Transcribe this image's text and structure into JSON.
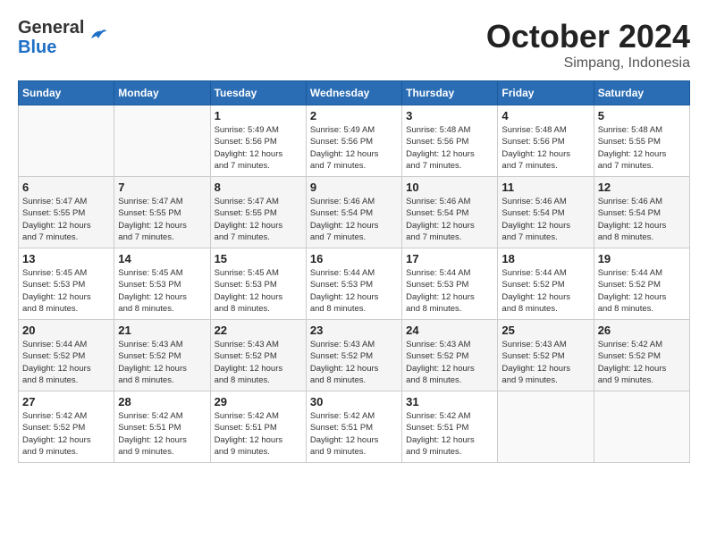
{
  "header": {
    "logo_general": "General",
    "logo_blue": "Blue",
    "month": "October 2024",
    "location": "Simpang, Indonesia"
  },
  "weekdays": [
    "Sunday",
    "Monday",
    "Tuesday",
    "Wednesday",
    "Thursday",
    "Friday",
    "Saturday"
  ],
  "weeks": [
    [
      {
        "day": "",
        "content": ""
      },
      {
        "day": "",
        "content": ""
      },
      {
        "day": "1",
        "content": "Sunrise: 5:49 AM\nSunset: 5:56 PM\nDaylight: 12 hours\nand 7 minutes."
      },
      {
        "day": "2",
        "content": "Sunrise: 5:49 AM\nSunset: 5:56 PM\nDaylight: 12 hours\nand 7 minutes."
      },
      {
        "day": "3",
        "content": "Sunrise: 5:48 AM\nSunset: 5:56 PM\nDaylight: 12 hours\nand 7 minutes."
      },
      {
        "day": "4",
        "content": "Sunrise: 5:48 AM\nSunset: 5:56 PM\nDaylight: 12 hours\nand 7 minutes."
      },
      {
        "day": "5",
        "content": "Sunrise: 5:48 AM\nSunset: 5:55 PM\nDaylight: 12 hours\nand 7 minutes."
      }
    ],
    [
      {
        "day": "6",
        "content": "Sunrise: 5:47 AM\nSunset: 5:55 PM\nDaylight: 12 hours\nand 7 minutes."
      },
      {
        "day": "7",
        "content": "Sunrise: 5:47 AM\nSunset: 5:55 PM\nDaylight: 12 hours\nand 7 minutes."
      },
      {
        "day": "8",
        "content": "Sunrise: 5:47 AM\nSunset: 5:55 PM\nDaylight: 12 hours\nand 7 minutes."
      },
      {
        "day": "9",
        "content": "Sunrise: 5:46 AM\nSunset: 5:54 PM\nDaylight: 12 hours\nand 7 minutes."
      },
      {
        "day": "10",
        "content": "Sunrise: 5:46 AM\nSunset: 5:54 PM\nDaylight: 12 hours\nand 7 minutes."
      },
      {
        "day": "11",
        "content": "Sunrise: 5:46 AM\nSunset: 5:54 PM\nDaylight: 12 hours\nand 7 minutes."
      },
      {
        "day": "12",
        "content": "Sunrise: 5:46 AM\nSunset: 5:54 PM\nDaylight: 12 hours\nand 8 minutes."
      }
    ],
    [
      {
        "day": "13",
        "content": "Sunrise: 5:45 AM\nSunset: 5:53 PM\nDaylight: 12 hours\nand 8 minutes."
      },
      {
        "day": "14",
        "content": "Sunrise: 5:45 AM\nSunset: 5:53 PM\nDaylight: 12 hours\nand 8 minutes."
      },
      {
        "day": "15",
        "content": "Sunrise: 5:45 AM\nSunset: 5:53 PM\nDaylight: 12 hours\nand 8 minutes."
      },
      {
        "day": "16",
        "content": "Sunrise: 5:44 AM\nSunset: 5:53 PM\nDaylight: 12 hours\nand 8 minutes."
      },
      {
        "day": "17",
        "content": "Sunrise: 5:44 AM\nSunset: 5:53 PM\nDaylight: 12 hours\nand 8 minutes."
      },
      {
        "day": "18",
        "content": "Sunrise: 5:44 AM\nSunset: 5:52 PM\nDaylight: 12 hours\nand 8 minutes."
      },
      {
        "day": "19",
        "content": "Sunrise: 5:44 AM\nSunset: 5:52 PM\nDaylight: 12 hours\nand 8 minutes."
      }
    ],
    [
      {
        "day": "20",
        "content": "Sunrise: 5:44 AM\nSunset: 5:52 PM\nDaylight: 12 hours\nand 8 minutes."
      },
      {
        "day": "21",
        "content": "Sunrise: 5:43 AM\nSunset: 5:52 PM\nDaylight: 12 hours\nand 8 minutes."
      },
      {
        "day": "22",
        "content": "Sunrise: 5:43 AM\nSunset: 5:52 PM\nDaylight: 12 hours\nand 8 minutes."
      },
      {
        "day": "23",
        "content": "Sunrise: 5:43 AM\nSunset: 5:52 PM\nDaylight: 12 hours\nand 8 minutes."
      },
      {
        "day": "24",
        "content": "Sunrise: 5:43 AM\nSunset: 5:52 PM\nDaylight: 12 hours\nand 8 minutes."
      },
      {
        "day": "25",
        "content": "Sunrise: 5:43 AM\nSunset: 5:52 PM\nDaylight: 12 hours\nand 9 minutes."
      },
      {
        "day": "26",
        "content": "Sunrise: 5:42 AM\nSunset: 5:52 PM\nDaylight: 12 hours\nand 9 minutes."
      }
    ],
    [
      {
        "day": "27",
        "content": "Sunrise: 5:42 AM\nSunset: 5:52 PM\nDaylight: 12 hours\nand 9 minutes."
      },
      {
        "day": "28",
        "content": "Sunrise: 5:42 AM\nSunset: 5:51 PM\nDaylight: 12 hours\nand 9 minutes."
      },
      {
        "day": "29",
        "content": "Sunrise: 5:42 AM\nSunset: 5:51 PM\nDaylight: 12 hours\nand 9 minutes."
      },
      {
        "day": "30",
        "content": "Sunrise: 5:42 AM\nSunset: 5:51 PM\nDaylight: 12 hours\nand 9 minutes."
      },
      {
        "day": "31",
        "content": "Sunrise: 5:42 AM\nSunset: 5:51 PM\nDaylight: 12 hours\nand 9 minutes."
      },
      {
        "day": "",
        "content": ""
      },
      {
        "day": "",
        "content": ""
      }
    ]
  ]
}
